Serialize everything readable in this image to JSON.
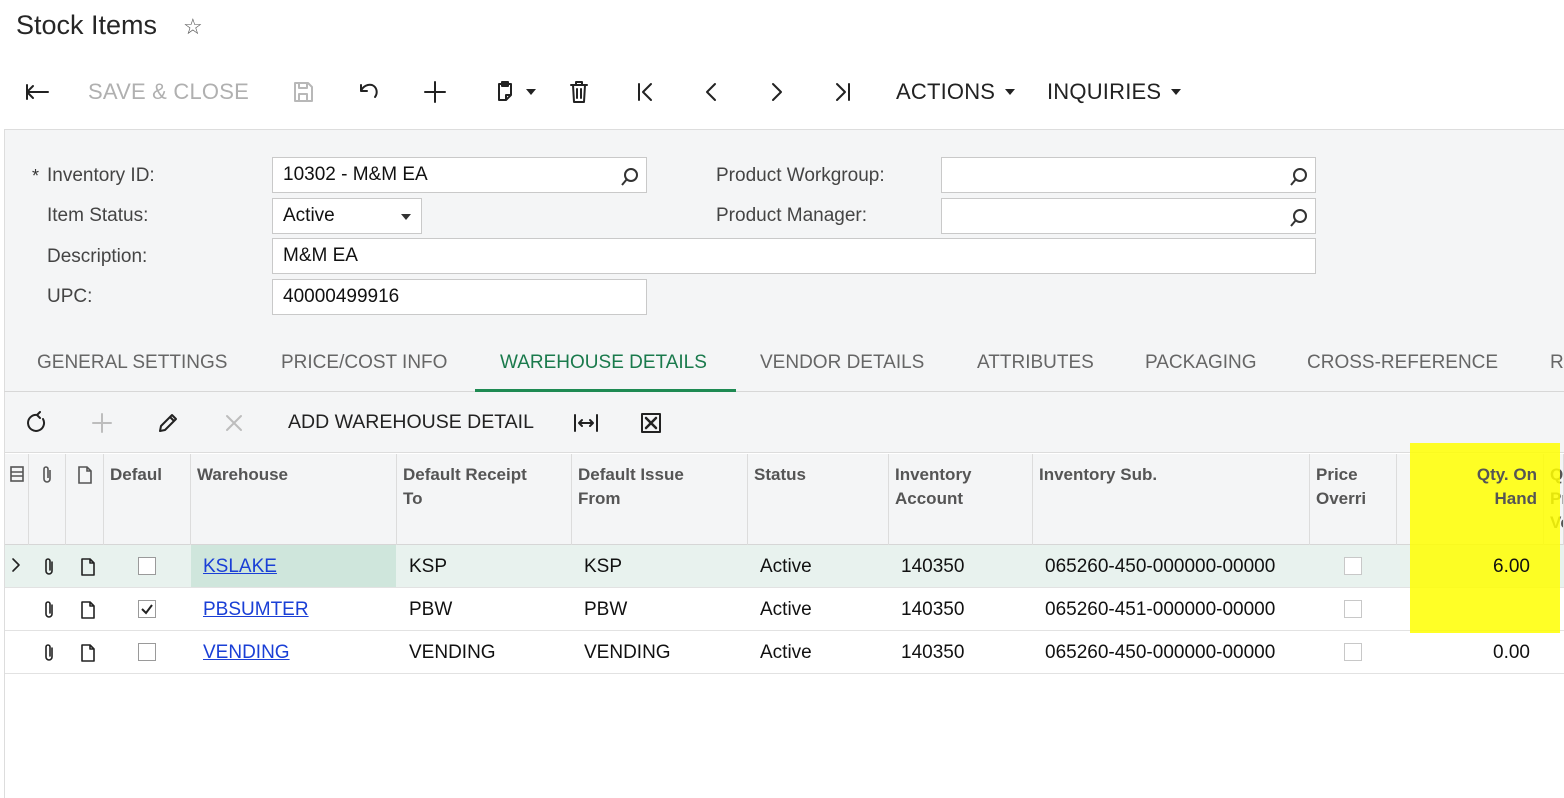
{
  "page": {
    "title": "Stock Items"
  },
  "toolbar": {
    "save_close_label": "SAVE & CLOSE",
    "actions_label": "ACTIONS",
    "inquiries_label": "INQUIRIES"
  },
  "form": {
    "inventory_id": {
      "label": "Inventory ID:",
      "required_mark": "*",
      "value": "10302 - M&M EA"
    },
    "item_status": {
      "label": "Item Status:",
      "value": "Active"
    },
    "description": {
      "label": "Description:",
      "value": "M&M EA"
    },
    "upc": {
      "label": "UPC:",
      "value": "40000499916"
    },
    "product_workgroup": {
      "label": "Product Workgroup:",
      "value": ""
    },
    "product_manager": {
      "label": "Product Manager:",
      "value": ""
    }
  },
  "tabs": [
    {
      "label": "GENERAL SETTINGS"
    },
    {
      "label": "PRICE/COST INFO"
    },
    {
      "label": "WAREHOUSE DETAILS",
      "active": true
    },
    {
      "label": "VENDOR DETAILS"
    },
    {
      "label": "ATTRIBUTES"
    },
    {
      "label": "PACKAGING"
    },
    {
      "label": "CROSS-REFERENCE"
    },
    {
      "label": "R"
    }
  ],
  "grid_toolbar": {
    "add_warehouse_detail_label": "ADD WAREHOUSE DETAIL"
  },
  "grid": {
    "columns": {
      "default": "Defaul",
      "warehouse": "Warehouse",
      "default_receipt_to_1": "Default Receipt",
      "default_receipt_to_2": "To",
      "default_issue_from_1": "Default Issue",
      "default_issue_from_2": "From",
      "status": "Status",
      "inventory_account_1": "Inventory",
      "inventory_account_2": "Account",
      "inventory_sub": "Inventory Sub.",
      "price_override_1": "Price",
      "price_override_2": "Overri",
      "qty_on_hand_1": "Qty. On",
      "qty_on_hand_2": "Hand",
      "next_col_1": "Q",
      "next_col_2": "Pr",
      "next_col_3": "Ve"
    },
    "rows": [
      {
        "default": false,
        "warehouse": "KSLAKE",
        "receipt_to": "KSP",
        "issue_from": "KSP",
        "status": "Active",
        "inventory_account": "140350",
        "inventory_sub": "065260-450-000000-00000",
        "price_override": false,
        "qty_on_hand": "6.00",
        "selected": true
      },
      {
        "default": true,
        "warehouse": "PBSUMTER",
        "receipt_to": "PBW",
        "issue_from": "PBW",
        "status": "Active",
        "inventory_account": "140350",
        "inventory_sub": "065260-451-000000-00000",
        "price_override": false,
        "qty_on_hand": ""
      },
      {
        "default": false,
        "warehouse": "VENDING",
        "receipt_to": "VENDING",
        "issue_from": "VENDING",
        "status": "Active",
        "inventory_account": "140350",
        "inventory_sub": "065260-450-000000-00000",
        "price_override": false,
        "qty_on_hand": "0.00"
      }
    ]
  },
  "colors": {
    "accent": "#1e8a53",
    "link": "#1a3fd6",
    "highlight": "#ffff00"
  }
}
